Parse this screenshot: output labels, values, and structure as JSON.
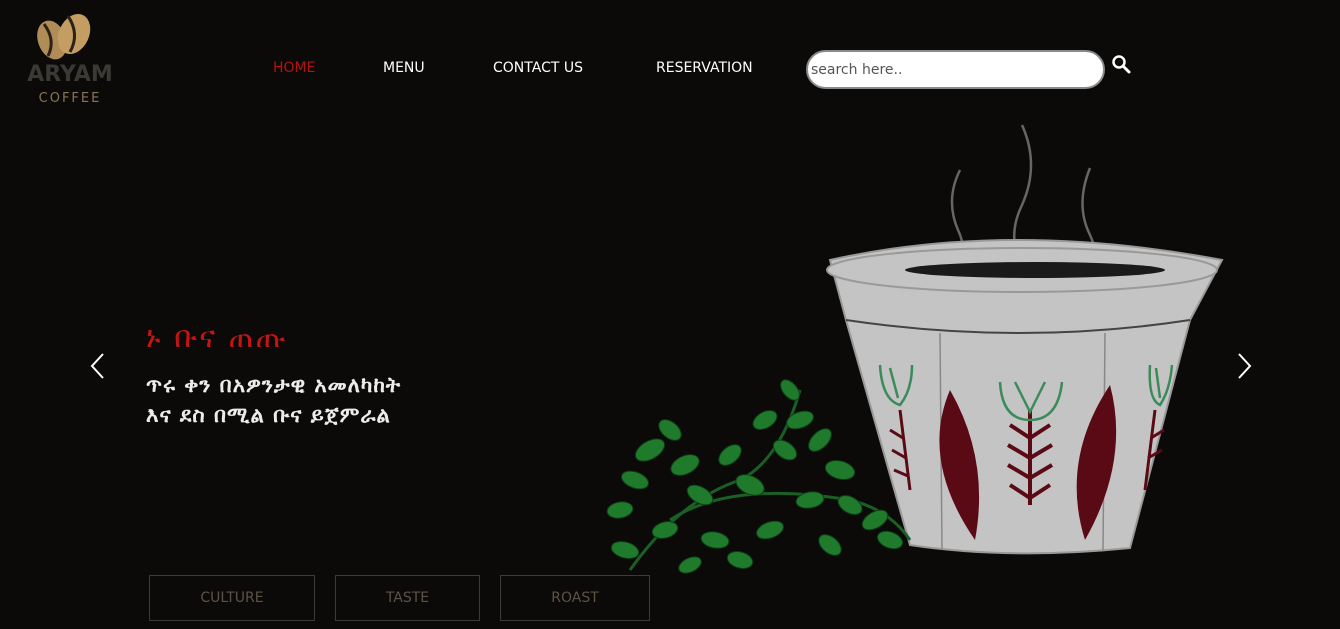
{
  "logo": {
    "word": "ARYAM",
    "sub": "COFFEE"
  },
  "nav": {
    "items": [
      {
        "label": "HOME",
        "active": true
      },
      {
        "label": "MENU",
        "active": false
      },
      {
        "label": "CONTACT US",
        "active": false
      },
      {
        "label": "RESERVATION",
        "active": false
      }
    ]
  },
  "search": {
    "placeholder": "search here..",
    "value": ""
  },
  "hero": {
    "title": "ኑ ቡና ጠጡ",
    "line1": "ጥሩ ቀን በአዎንታዊ አመለካከት",
    "line2": "እና ደስ በሚል ቡና ይጀምራል"
  },
  "tabs": [
    {
      "label": "CULTURE"
    },
    {
      "label": "TASTE"
    },
    {
      "label": "ROAST"
    }
  ],
  "colors": {
    "background": "#0b0a09",
    "accent": "#b31212",
    "logo_gold": "#8a7553",
    "cup": "#c4c4c4",
    "cup_pattern": "#5a0a14",
    "leaf": "#1f7a2c"
  },
  "icons": {
    "search": "search-icon",
    "prev": "chevron-left-icon",
    "next": "chevron-right-icon"
  }
}
